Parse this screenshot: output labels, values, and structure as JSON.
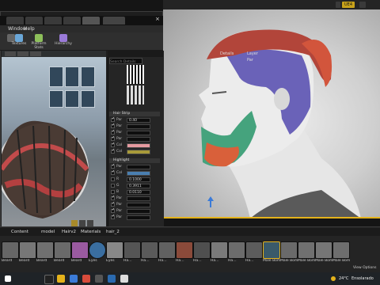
{
  "top_right": {
    "badge": "UE4",
    "label": ""
  },
  "viewport_menu": {
    "perspective": "",
    "lit": "",
    "show": ""
  },
  "tabs": [
    "",
    "",
    "",
    "",
    ""
  ],
  "menu": [
    "Window",
    "Help"
  ],
  "toolbar": {
    "items": [
      "Textures",
      "Platform Stats",
      "Hierarchy"
    ]
  },
  "details": {
    "tab_details": "Details",
    "tab_layer": "Layer Par",
    "search_placeholder": "Search Details",
    "section_hair": "Hair Strip",
    "section_highlight": "Highlight",
    "hair_values": [
      "",
      "0.40",
      "",
      "",
      "",
      "",
      "",
      ""
    ],
    "highlight_values": [
      "",
      "",
      "0.1000",
      "0.3911",
      "0.0110",
      "",
      "",
      ""
    ]
  },
  "preview_footer": "",
  "content_path": [
    "Content",
    "model",
    "Hairv2",
    "Materials",
    "hair_2"
  ],
  "assets": [
    "Beard",
    "Beard",
    "Beard",
    "Beard",
    "Beard",
    "Eyes",
    "Eyes",
    "Ha…",
    "Ha…",
    "Ha…",
    "Ha…",
    "Ha…",
    "Ha…",
    "Ha…",
    "Ha…",
    "Male Bome",
    "Male Bome",
    "Male Bome",
    "Male Bome",
    "Male Bome"
  ],
  "view_options": "View Options",
  "taskbar": {
    "weather": "24°C",
    "weather_text": "Ensolarado",
    "colors": {
      "accent": "#e4b21b"
    }
  }
}
